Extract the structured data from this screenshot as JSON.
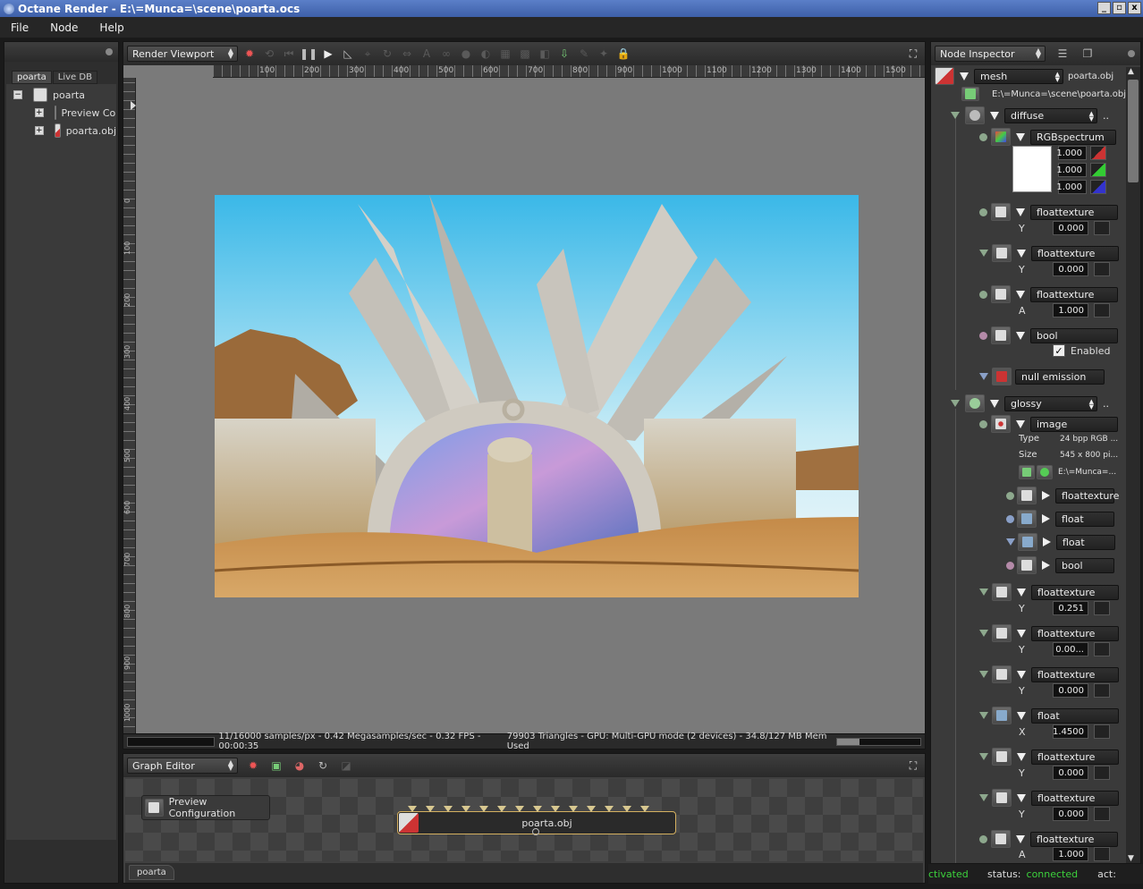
{
  "window": {
    "title": "Octane Render - E:\\=Munca=\\scene\\poarta.ocs",
    "min": "_",
    "max": "▫",
    "close": "x"
  },
  "menu": [
    "File",
    "Node",
    "Help"
  ],
  "scene_panel": {
    "tabs": [
      "poarta",
      "Live DB"
    ],
    "tree": [
      {
        "label": "poarta",
        "toggle": "−"
      },
      {
        "label": "Preview Configuration",
        "toggle": "+"
      },
      {
        "label": "poarta.obj",
        "toggle": "+"
      }
    ]
  },
  "viewport": {
    "combo": "Render Viewport",
    "ruler_x": [
      "100",
      "200",
      "300",
      "400",
      "500",
      "600",
      "700",
      "800",
      "900",
      "1000",
      "1100",
      "1200",
      "1300",
      "1400",
      "1500"
    ],
    "ruler_y": [
      "0",
      "100",
      "200",
      "300",
      "400",
      "500",
      "600",
      "700",
      "800",
      "900",
      "1000",
      "1100"
    ],
    "status_left": "11/16000 samples/px - 0.42 Megasamples/sec - 0.32 FPS - 00:00:35",
    "status_right": "79903 Triangles - GPU: Multi-GPU mode (2 devices) - 34.8/127 MB Mem Used"
  },
  "graph_editor": {
    "combo": "Graph Editor",
    "node1": "Preview Configuration",
    "node2": "poarta.obj",
    "tab": "poarta"
  },
  "inspector": {
    "combo": "Node Inspector",
    "mesh_combo": "mesh",
    "mesh_name": "poarta.obj",
    "mesh_path": "E:\\=Munca=\\scene\\poarta.obj",
    "diffuse_combo": "diffuse",
    "dots": "..",
    "rgb": {
      "name": "RGBspectrum",
      "r": "1.000",
      "g": "1.000",
      "b": "1.000"
    },
    "d_ft1": {
      "name": "floattexture",
      "label": "Y",
      "value": "0.000"
    },
    "d_ft2": {
      "name": "floattexture",
      "label": "Y",
      "value": "0.000"
    },
    "d_ft3": {
      "name": "floattexture",
      "label": "A",
      "value": "1.000"
    },
    "d_bool": {
      "name": "bool",
      "check": "✓",
      "label": "Enabled"
    },
    "d_null": {
      "name": "null emission"
    },
    "glossy_combo": "glossy",
    "image": {
      "name": "image",
      "type_label": "Type",
      "type_val": "24 bpp RGB ...",
      "size_label": "Size",
      "size_val": "545 x 800 pi...",
      "path_val": "E:\\=Munca=..."
    },
    "img_sub": [
      "floattexture",
      "float",
      "float",
      "bool"
    ],
    "g_ft1": {
      "name": "floattexture",
      "label": "Y",
      "value": "0.251"
    },
    "g_ft2": {
      "name": "floattexture",
      "label": "Y",
      "value": "0.00..."
    },
    "g_ft3": {
      "name": "floattexture",
      "label": "Y",
      "value": "0.000"
    },
    "g_float": {
      "name": "float",
      "label": "X",
      "value": "1.4500"
    },
    "g_ft4": {
      "name": "floattexture",
      "label": "Y",
      "value": "0.000"
    },
    "g_ft5": {
      "name": "floattexture",
      "label": "Y",
      "value": "0.000"
    },
    "g_ft6": {
      "name": "floattexture",
      "label": "A",
      "value": "1.000"
    }
  },
  "bottom_status": {
    "activated": "ctivated",
    "status_label": "status:",
    "status_value": "connected",
    "act_label": "act:"
  },
  "colors": {
    "connected": "#3cd23c",
    "activated": "#3cd23c",
    "accent_node": "#d4b060"
  }
}
